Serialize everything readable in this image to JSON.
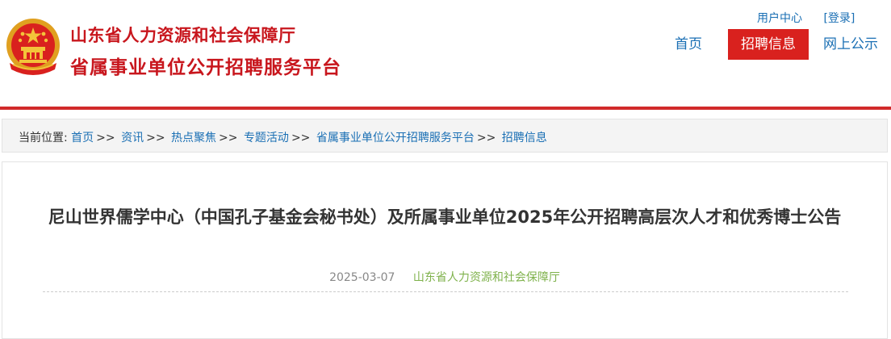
{
  "header": {
    "site_title_1": "山东省人力资源和社会保障厅",
    "site_title_2": "省属事业单位公开招聘服务平台",
    "emblem_icon": "national-emblem-icon",
    "top_links": {
      "user_center": "用户中心",
      "login": "[登录]"
    },
    "nav": {
      "home": "首页",
      "recruit_info": "招聘信息",
      "online_public": "网上公示"
    }
  },
  "breadcrumb": {
    "label": "当前位置:",
    "items": [
      "首页",
      "资讯",
      "热点聚焦",
      "专题活动",
      "省属事业单位公开招聘服务平台",
      "招聘信息"
    ],
    "separator": ">>"
  },
  "article": {
    "title": "尼山世界儒学中心（中国孔子基金会秘书处）及所属事业单位2025年公开招聘高层次人才和优秀博士公告",
    "date": "2025-03-07",
    "source": "山东省人力资源和社会保障厅"
  },
  "colors": {
    "brand_red": "#c8161d",
    "nav_active_bg": "#d9211e",
    "link_blue": "#1a6fb4",
    "source_green": "#7fb24c"
  }
}
